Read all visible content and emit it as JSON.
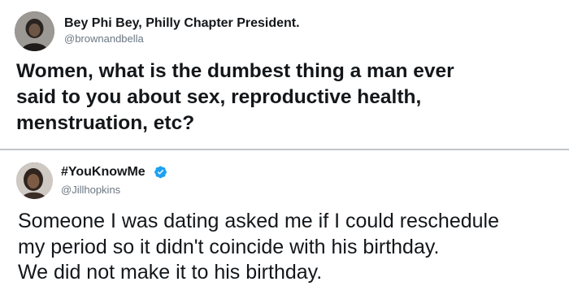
{
  "tweet_1": {
    "display_name": "Bey Phi Bey, Philly Chapter President.",
    "handle": "@brownandbella",
    "text_lines": [
      "Women, what is the dumbest thing a man ever",
      "said to you about sex, reproductive health,",
      "menstruation, etc?"
    ],
    "avatar": "profile-photo"
  },
  "tweet_2": {
    "display_name": "#YouKnowMe",
    "handle": "@Jillhopkins",
    "verified": true,
    "verified_color": "#1da1f2",
    "text_lines": [
      "Someone I was dating asked me if I could reschedule",
      "my period so it didn't coincide with his birthday.",
      "We did not make it to his birthday."
    ],
    "avatar": "profile-photo"
  },
  "colors": {
    "text": "#14171a",
    "handle": "#6b7782",
    "divider": "#bfc5ca"
  }
}
